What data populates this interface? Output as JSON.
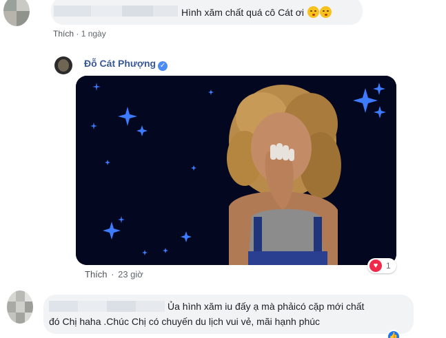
{
  "comment1": {
    "text": "Hình xăm chất quá cô Cát ơi",
    "emoji_names": [
      "kissing-face-icon",
      "kissing-face-icon"
    ],
    "like_label": "Thích",
    "separator": "·",
    "time": "1 ngày"
  },
  "reply": {
    "author": "Đỗ Cát Phượng",
    "verified_glyph": "✓",
    "like_label": "Thích",
    "time": "23 giờ",
    "reaction_count": "1",
    "reaction_icon": "heart-icon"
  },
  "comment2": {
    "line1": "Ủa hình xăm iu đấy ạ mà phảicó cặp mới chất",
    "line2": "đó Chị haha .Chúc Chị có chuyến du lịch vui vẻ, mãi hạnh phúc",
    "like_icon": "thumbs-up-icon"
  },
  "colors": {
    "link": "#385898",
    "bubble": "#f2f3f5",
    "meta": "#606770",
    "gif_background": "#03071f",
    "stars": "#3d7bff",
    "heart": "#f0284a"
  }
}
